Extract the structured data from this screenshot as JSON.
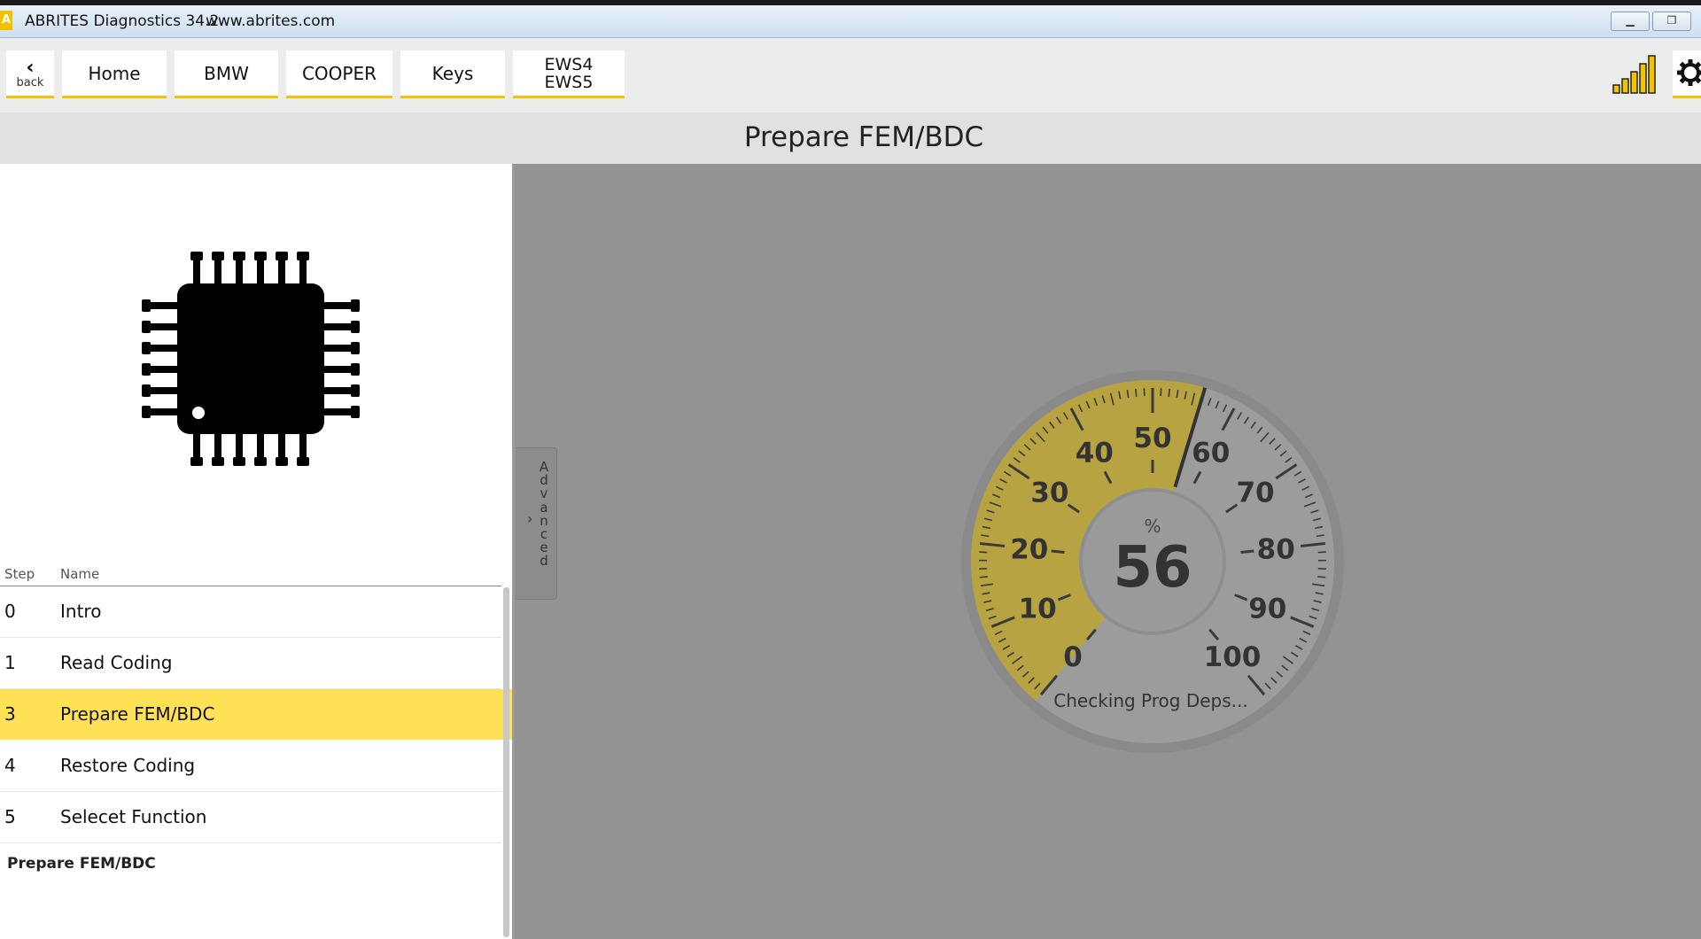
{
  "window": {
    "title": "ABRITES Diagnostics 34.2",
    "url": "www.abrites.com",
    "icon_letter": "A",
    "controls": [
      "minimize-icon",
      "restore-icon"
    ]
  },
  "toolbar": {
    "back_label": "back",
    "back_icon": "chevron-left-icon",
    "breadcrumbs": [
      "Home",
      "BMW",
      "COOPER",
      "Keys"
    ],
    "last_crumb_line1": "EWS4",
    "last_crumb_line2": "EWS5",
    "signal_icon": "signal-bars-icon",
    "settings_icon": "gear-icon",
    "accent_color": "#f0c400"
  },
  "page": {
    "title": "Prepare FEM/BDC"
  },
  "steps": {
    "headers": {
      "step": "Step",
      "name": "Name"
    },
    "rows": [
      {
        "step": "0",
        "name": "Intro"
      },
      {
        "step": "1",
        "name": "Read Coding"
      },
      {
        "step": "3",
        "name": "Prepare FEM/BDC"
      },
      {
        "step": "4",
        "name": "Restore Coding"
      },
      {
        "step": "5",
        "name": "Selecet Function"
      }
    ],
    "selected_index": 2,
    "selected_color": "#ffe155",
    "description": "Prepare FEM/BDC"
  },
  "advanced_tab": {
    "label": "Advanced",
    "arrow": "›"
  },
  "gauge": {
    "unit": "%",
    "value": "56",
    "progress": 56,
    "min": 0,
    "max": 100,
    "tick_labels": [
      "0",
      "10",
      "20",
      "30",
      "40",
      "50",
      "60",
      "70",
      "80",
      "90",
      "100"
    ],
    "fill_color": "#b8a342",
    "status": "Checking Prog Deps..."
  }
}
